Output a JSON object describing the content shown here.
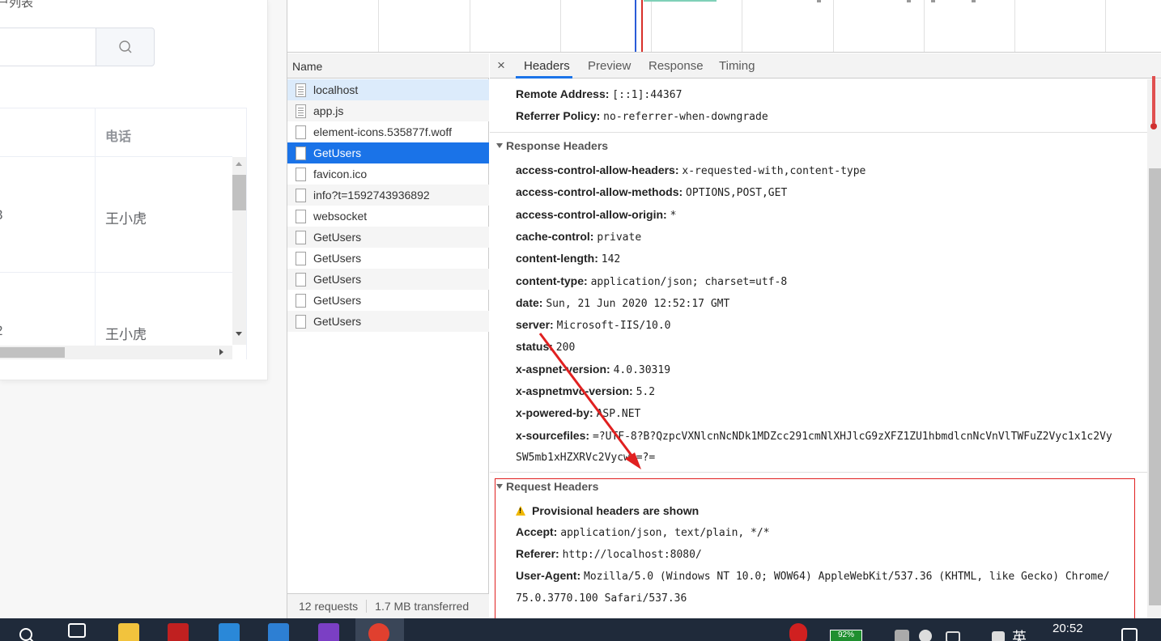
{
  "left_page": {
    "title": "户列表",
    "table": {
      "column_phone": "电话",
      "rows": [
        {
          "cut": "3",
          "name": "王小虎"
        },
        {
          "cut": "2",
          "name": "王小虎"
        }
      ]
    }
  },
  "devtools": {
    "name_header": "Name",
    "requests": [
      {
        "name": "localhost",
        "icon": "doc-lines"
      },
      {
        "name": "app.js",
        "icon": "doc-lines"
      },
      {
        "name": "element-icons.535877f.woff",
        "icon": "doc"
      },
      {
        "name": "GetUsers",
        "icon": "doc"
      },
      {
        "name": "favicon.ico",
        "icon": "doc"
      },
      {
        "name": "info?t=1592743936892",
        "icon": "doc"
      },
      {
        "name": "websocket",
        "icon": "doc"
      },
      {
        "name": "GetUsers",
        "icon": "doc"
      },
      {
        "name": "GetUsers",
        "icon": "doc"
      },
      {
        "name": "GetUsers",
        "icon": "doc"
      },
      {
        "name": "GetUsers",
        "icon": "doc"
      },
      {
        "name": "GetUsers",
        "icon": "doc"
      }
    ],
    "selected_request": "GetUsers",
    "status": {
      "requests": "12 requests",
      "transferred": "1.7 MB transferred"
    },
    "tabs": {
      "close": "×",
      "headers": "Headers",
      "preview": "Preview",
      "response": "Response",
      "timing": "Timing",
      "active": "Headers"
    },
    "general": [
      {
        "key": "Remote Address:",
        "value": "[::1]:44367"
      },
      {
        "key": "Referrer Policy:",
        "value": "no-referrer-when-downgrade"
      }
    ],
    "response_headers": {
      "title": "Response Headers",
      "items": [
        {
          "key": "access-control-allow-headers:",
          "value": "x-requested-with,content-type"
        },
        {
          "key": "access-control-allow-methods:",
          "value": "OPTIONS,POST,GET"
        },
        {
          "key": "access-control-allow-origin:",
          "value": "*"
        },
        {
          "key": "cache-control:",
          "value": "private"
        },
        {
          "key": "content-length:",
          "value": "142"
        },
        {
          "key": "content-type:",
          "value": "application/json; charset=utf-8"
        },
        {
          "key": "date:",
          "value": "Sun, 21 Jun 2020 12:52:17 GMT"
        },
        {
          "key": "server:",
          "value": "Microsoft-IIS/10.0"
        },
        {
          "key": "status:",
          "value": "200"
        },
        {
          "key": "x-aspnet-version:",
          "value": "4.0.30319"
        },
        {
          "key": "x-aspnetmvc-version:",
          "value": "5.2"
        },
        {
          "key": "x-powered-by:",
          "value": "ASP.NET"
        },
        {
          "key": "x-sourcefiles:",
          "value": "=?UTF-8?B?QzpcVXNlcnNcNDk1MDZcc291cmNlXHJlcG9zXFZ1ZU1hbmdlcnNcVnVlTWFuZ2Vyc1x1c2Vy"
        }
      ],
      "continuation": "SW5mb1xHZXRVc2Vycw==?="
    },
    "request_headers": {
      "title": "Request Headers",
      "warning": "Provisional headers are shown",
      "items": [
        {
          "key": "Accept:",
          "value": "application/json, text/plain, */*"
        },
        {
          "key": "Referer:",
          "value": "http://localhost:8080/"
        },
        {
          "key": "User-Agent:",
          "value": "Mozilla/5.0 (Windows NT 10.0; WOW64) AppleWebKit/537.36 (KHTML, like Gecko) Chrome/"
        }
      ],
      "continuation": "75.0.3770.100 Safari/537.36"
    }
  },
  "taskbar": {
    "battery": "92%",
    "ime": "英",
    "clock": "20:52"
  },
  "colors": {
    "accent": "#1a73e8",
    "annotation": "#e02020"
  }
}
